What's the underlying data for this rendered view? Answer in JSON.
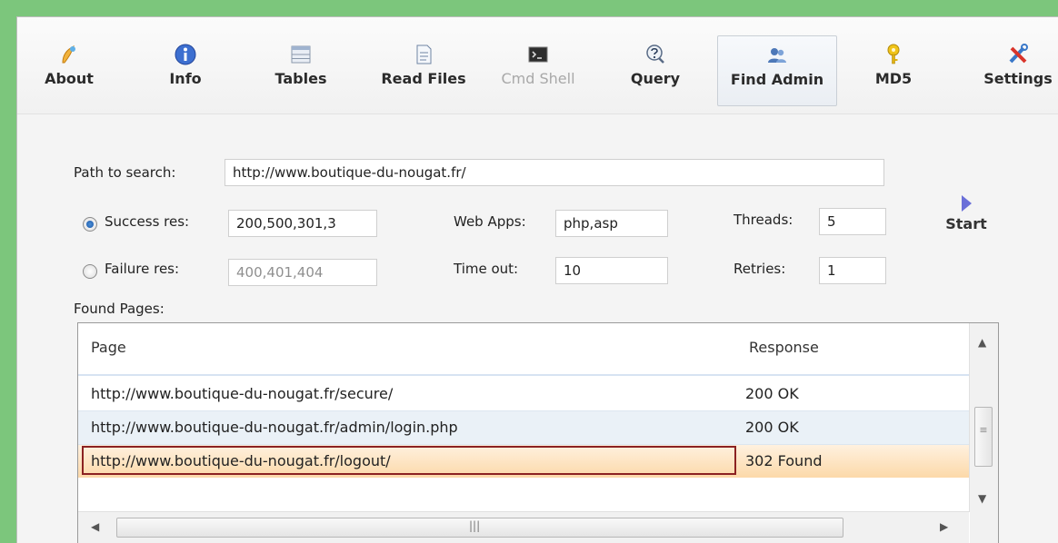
{
  "toolbar": {
    "about": "About",
    "info": "Info",
    "tables": "Tables",
    "read_files": "Read Files",
    "cmd_shell": "Cmd Shell",
    "query": "Query",
    "find_admin": "Find Admin",
    "md5": "MD5",
    "settings": "Settings"
  },
  "form": {
    "path_label": "Path to search:",
    "path_value": "http://www.boutique-du-nougat.fr/",
    "success_label": "Success res:",
    "success_value": "200,500,301,3",
    "failure_label": "Failure res:",
    "failure_value": "400,401,404",
    "webapps_label": "Web Apps:",
    "webapps_value": "php,asp",
    "timeout_label": "Time out:",
    "timeout_value": "10",
    "threads_label": "Threads:",
    "threads_value": "5",
    "retries_label": "Retries:",
    "retries_value": "1",
    "start_label": "Start",
    "selected_mode": "success"
  },
  "results": {
    "label": "Found Pages:",
    "columns": [
      "Page",
      "Response"
    ],
    "rows": [
      {
        "page": "http://www.boutique-du-nougat.fr/secure/",
        "response": "200 OK"
      },
      {
        "page": "http://www.boutique-du-nougat.fr/admin/login.php",
        "response": "200 OK"
      },
      {
        "page": "http://www.boutique-du-nougat.fr/logout/",
        "response": "302 Found"
      }
    ],
    "selected_row": 2
  },
  "colors": {
    "background": "#7cc67c",
    "selection": "#fcd9a9",
    "focus_border": "#8b2222",
    "alt_row": "#eaf1f7"
  },
  "icons": [
    "about-icon",
    "info-icon",
    "tables-icon",
    "read-files-icon",
    "cmd-shell-icon",
    "query-icon",
    "find-admin-icon",
    "md5-icon",
    "settings-icon",
    "start-icon"
  ]
}
